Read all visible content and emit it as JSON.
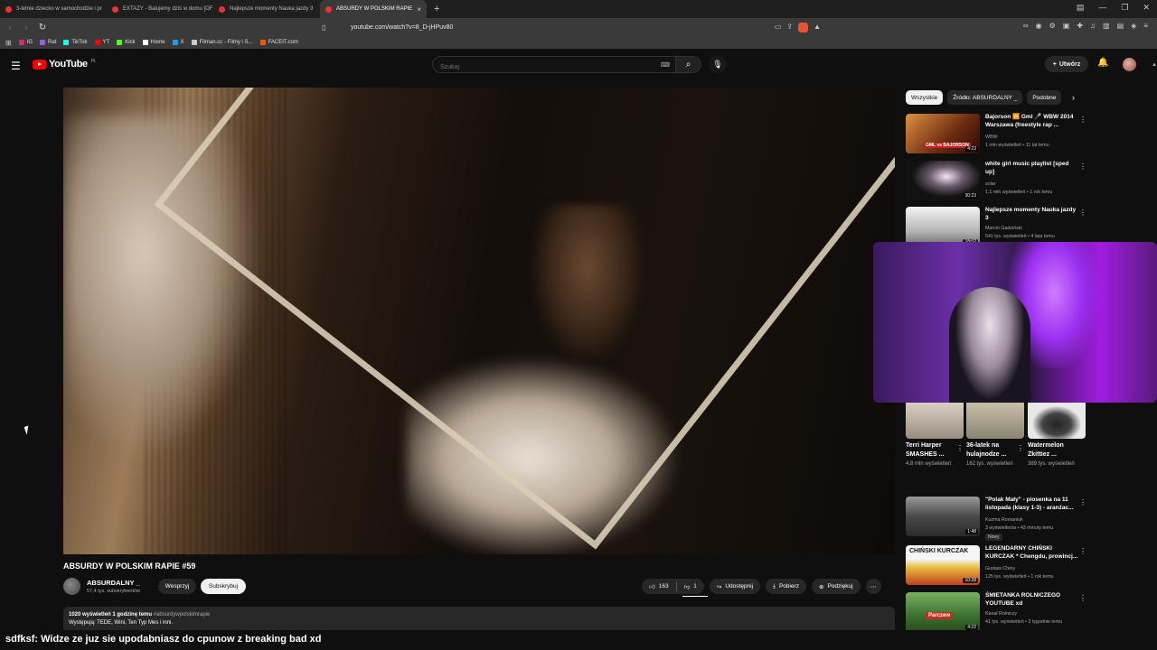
{
  "browser": {
    "tabs": [
      {
        "label": "3-letnie dziecko w samochodzie i pr",
        "active": false
      },
      {
        "label": "EXTAZY - Balujemy dziś w domu [OF",
        "active": false
      },
      {
        "label": "Najlepsze momenty Nauka jazdy 3",
        "active": false
      },
      {
        "label": "ABSURDY W POLSKIM RAPIE",
        "active": true
      }
    ],
    "tab_close": "×",
    "new_tab": "+",
    "window_controls": [
      "▤",
      "—",
      "❐",
      "✕"
    ],
    "url": "youtube.com/watch?v=8_D-jHPuv80",
    "bookmarks": [
      {
        "label": "IG",
        "color": "#d62976"
      },
      {
        "label": "Rat",
        "color": "#9b5de5"
      },
      {
        "label": "TikTok",
        "color": "#25f4ee"
      },
      {
        "label": "YT",
        "color": "#ff0000"
      },
      {
        "label": "Kick",
        "color": "#53fc18"
      },
      {
        "label": "Home",
        "color": "#ffffff"
      },
      {
        "label": "X",
        "color": "#1d9bf0"
      },
      {
        "label": "Filman.cc - Filmy i S...",
        "color": "#cccccc"
      },
      {
        "label": "FACEIT.com",
        "color": "#ff5500"
      }
    ],
    "colors": {
      "brave": "#e8542f",
      "tab_active_bg": "#3a3a3a"
    }
  },
  "youtube": {
    "logo_text": "YouTube",
    "logo_region": "PL",
    "search_placeholder": "Szukaj",
    "create_label": "Utwórz",
    "accent": "#ff0000"
  },
  "video": {
    "title": "ABSURDY W POLSKIM RAPIE #59",
    "channel": "ABSURDALNY _",
    "subscribers": "57,4 tys. subskrybentów",
    "support_label": "Wesprzyj",
    "subscribe_label": "Subskrybuj",
    "likes": "163",
    "dislikes": "1",
    "share_label": "Udostępnij",
    "download_label": "Pobierz",
    "thanks_label": "Podziękuj",
    "views_time": "1020 wyświetleń  1 godzinę temu",
    "hashtag": "#absurdywpolskimrapie",
    "description": "Występują: TEDE, Wini, Ten Typ Mes i inni."
  },
  "chips": [
    "Wszystkie",
    "Źródło: ABSURDALNY _",
    "Podobne"
  ],
  "recommendations_top": [
    {
      "title": "Bajorson 🆚 Gml 🎤 WBW 2014 Warszawa (freestyle rap ...",
      "channel": "WBW",
      "meta": "1 mln wyświetleń • 11 lat temu",
      "duration": "4:23",
      "colors": [
        "#d08030",
        "#3a1a0a"
      ]
    },
    {
      "title": "white girl music playlist [sped up]",
      "channel": "solar",
      "meta": "1,1 mln wyświetleń • 1 rok temu",
      "duration": "30:23",
      "colors": [
        "#e0e0e0",
        "#1a1a1a"
      ]
    },
    {
      "title": "Najlepsze momenty Nauka jazdy 3",
      "channel": "Marcin Gadziński",
      "meta": "541 tys. wyświetleń • 4 lata temu",
      "duration": "18:02",
      "colors": [
        "#f0f0f0",
        "#9a9a9a"
      ]
    }
  ],
  "shorts": [
    {
      "title": "Terri Harper SMASHES ...",
      "views": "4,8 mln wyświetleń",
      "color": "#d8c8b8"
    },
    {
      "title": "36-latek na hulajnodze ...",
      "views": "162 tys. wyświetleń",
      "color": "#bdb8a8"
    },
    {
      "title": "Watermelon Zkittiez ...",
      "views": "389 tys. wyświetleń",
      "color": "#e0e0e0"
    }
  ],
  "recommendations_bottom": [
    {
      "title": "\"Polak Mały\" - piosenka na 11 listopada (klasy 1-3) - aranżac...",
      "channel": "Kuzma Romaniuk",
      "meta": "3 wyświetlenia • 43 minuty temu",
      "duration": "1:48",
      "badge": "Nowy",
      "colors": [
        "#8a8a8a",
        "#3a3a3a"
      ]
    },
    {
      "title": "LEGENDARNY CHIŃSKI KURCZAK * Chengdu, prowincj...",
      "channel": "Gustaw Chiny",
      "meta": "125 tys. wyświetleń • 1 rok temu",
      "duration": "10:28",
      "badge": "",
      "colors": [
        "#f0d040",
        "#c03020"
      ]
    },
    {
      "title": "ŚMIETANKA ROLNICZEGO YOUTUBE xd",
      "channel": "Kanał Rolniczy",
      "meta": "41 tys. wyświetleń • 2 tygodnie temu",
      "duration": "4:22",
      "badge": "",
      "colors": [
        "#6aa050",
        "#2a5020"
      ]
    }
  ],
  "thumb_texts": {
    "rec_top_0": "GML vs BAJORSON",
    "rec_bottom_1": "CHIŃSKI KURCZAK",
    "rec_bottom_2": "Parczew"
  },
  "chat": {
    "user": "sdfksf",
    "message": ": Widze ze juz sie upodabniasz do cpunow z breaking bad  xd"
  }
}
